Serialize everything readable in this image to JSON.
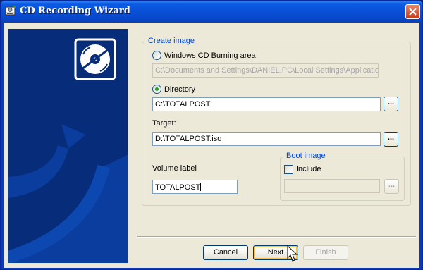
{
  "window": {
    "title": "CD Recording Wizard",
    "icon": "cd-burner-icon",
    "close_icon": "close-icon"
  },
  "art": {
    "icon": "cd-disc-icon"
  },
  "create_image": {
    "legend": "Create image",
    "option_burning_area": {
      "label": "Windows CD Burning area",
      "selected": false,
      "path": "C:\\Documents and Settings\\DANIEL.PC\\Local Settings\\Application"
    },
    "option_directory": {
      "label": "Directory",
      "selected": true,
      "path": "C:\\TOTALPOST",
      "browse_label": "..."
    },
    "target": {
      "label": "Target:",
      "value": "D:\\TOTALPOST.iso",
      "browse_label": "..."
    },
    "volume_label": {
      "label": "Volume label",
      "value": "TOTALPOST"
    },
    "boot_image": {
      "legend": "Boot image",
      "include_label": "Include",
      "include_checked": false,
      "path": "",
      "browse_label": "..."
    }
  },
  "buttons": {
    "cancel": "Cancel",
    "next": "Next",
    "finish": "Finish"
  },
  "colors": {
    "titlebar": "#0a51d9",
    "dialog_bg": "#ece9d8",
    "art_bg": "#072c79",
    "groupbox_title": "#0046d5",
    "radio_dot": "#21a121",
    "close_button": "#c73b16",
    "default_button_ring": "#f6c052"
  }
}
